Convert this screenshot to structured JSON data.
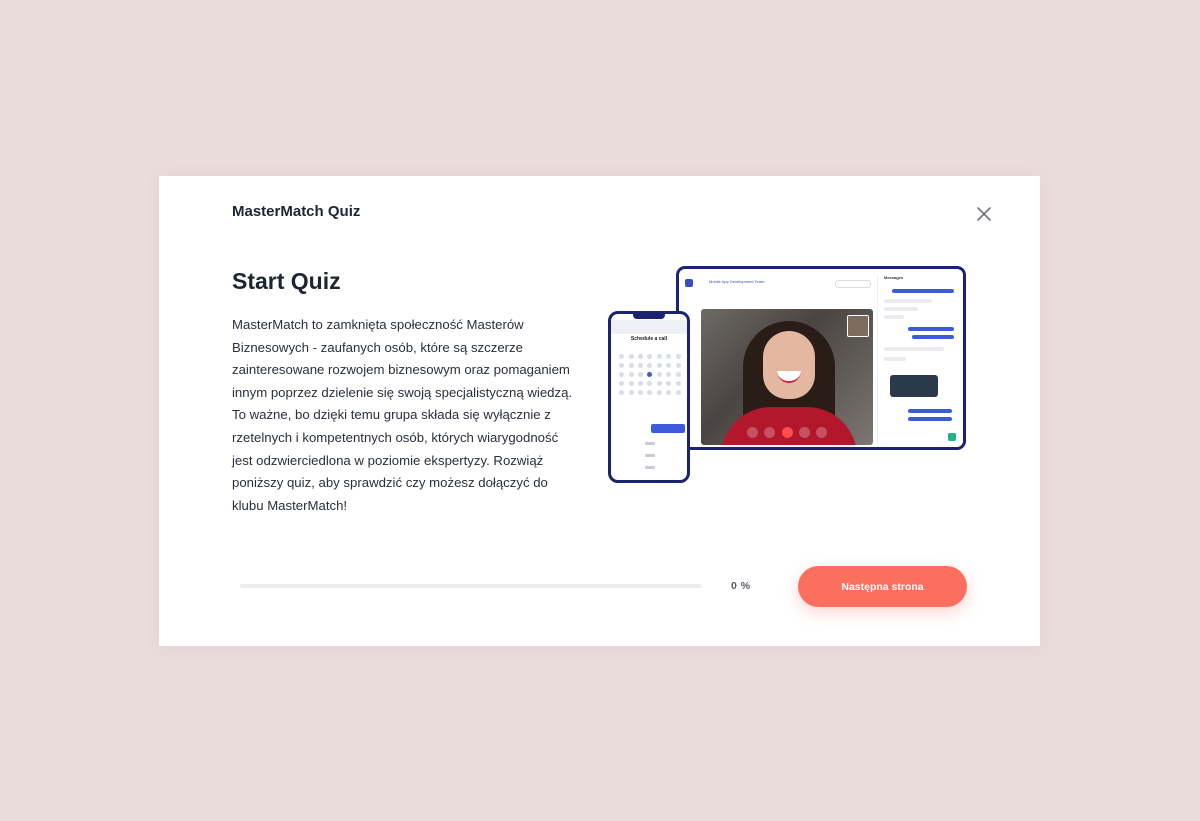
{
  "colors": {
    "background": "#eadcdb",
    "accent": "#fa6f5d",
    "device_frame": "#1c2470",
    "ui_blue": "#3b5bdb"
  },
  "modal": {
    "title": "MasterMatch Quiz",
    "close_icon": "close-icon"
  },
  "intro": {
    "heading": "Start Quiz",
    "description_lines": [
      "MasterMatch to zamknięta społeczność Masterów",
      "Biznesowych - zaufanych osób, które są szczerze",
      "zainteresowane rozwojem biznesowym oraz pomaganiem",
      "innym poprzez dzielenie się swoją specjalistyczną wiedzą.",
      "To ważne, bo dzięki temu grupa składa się wyłącznie z",
      "rzetelnych i kompetentnych osób, których wiarygodność",
      "jest odzwierciedlona w poziomie ekspertyzy. Rozwiąż",
      "poniższy quiz, aby sprawdzić czy możesz dołączyć do",
      "klubu MasterMatch!"
    ]
  },
  "illustration": {
    "tablet_app_title": "Mobile App Development Team",
    "chat_header": "Messages",
    "phone_title": "Schedule a call"
  },
  "progress": {
    "value": 0,
    "label": "0 %"
  },
  "footer": {
    "next_label": "Następna strona"
  }
}
